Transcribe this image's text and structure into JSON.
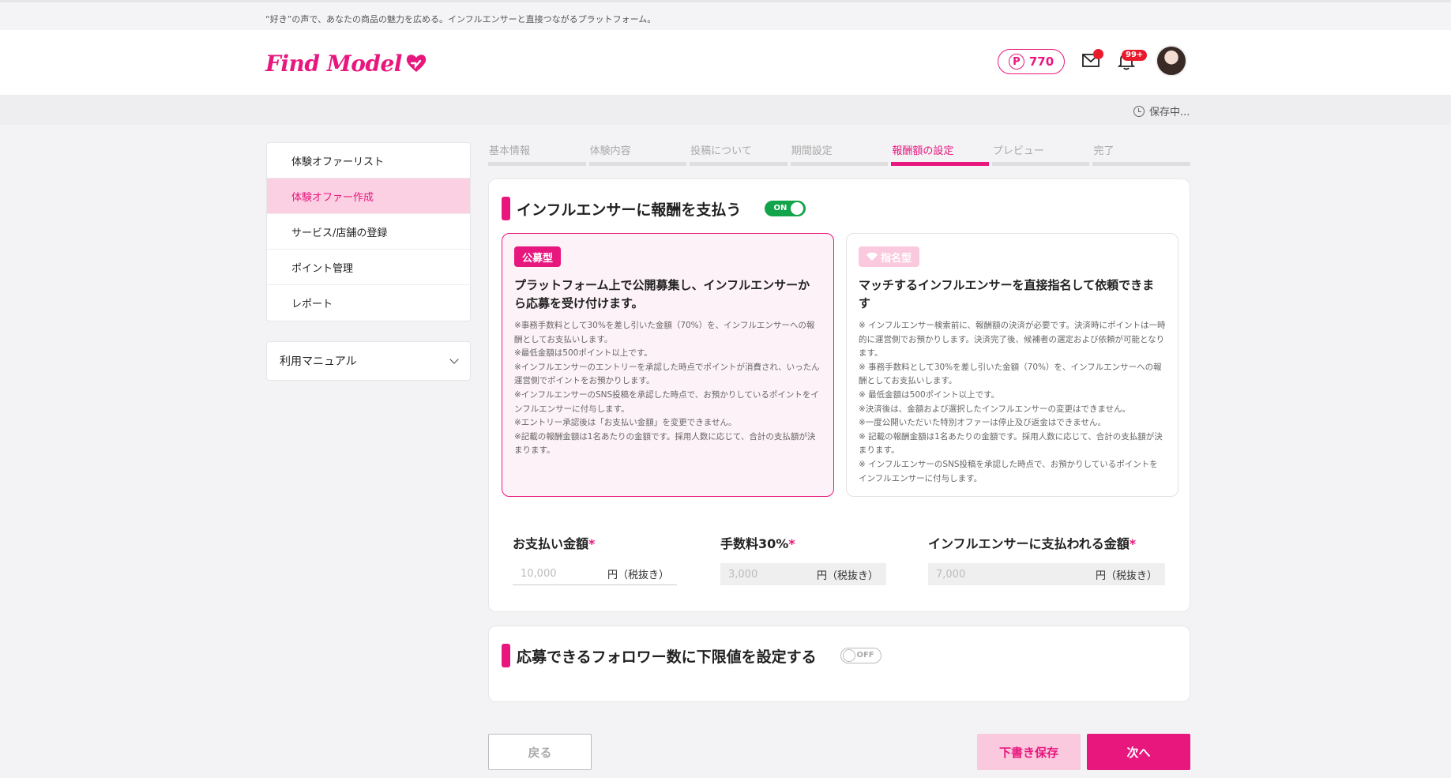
{
  "tagline": "“好き”の声で、あなたの商品の魅力を広める。インフルエンサーと直接つながるプラットフォーム。",
  "brand": {
    "logo_text": "Find Model",
    "accent": "#e8177e"
  },
  "header": {
    "points_symbol": "P",
    "points": "770",
    "mail_icon": "mail-icon",
    "bell_icon": "bell-icon",
    "notification_badge": "99+"
  },
  "saving_status": "保存中...",
  "sidebar": {
    "items": [
      {
        "label": "体験オファーリスト",
        "active": false
      },
      {
        "label": "体験オファー作成",
        "active": true
      },
      {
        "label": "サービス/店舗の登録",
        "active": false
      },
      {
        "label": "ポイント管理",
        "active": false
      },
      {
        "label": "レポート",
        "active": false
      }
    ],
    "manual": "利用マニュアル"
  },
  "steps": [
    {
      "label": "基本情報",
      "active": false
    },
    {
      "label": "体験内容",
      "active": false
    },
    {
      "label": "投稿について",
      "active": false
    },
    {
      "label": "期間設定",
      "active": false
    },
    {
      "label": "報酬額の設定",
      "active": true
    },
    {
      "label": "プレビュー",
      "active": false
    },
    {
      "label": "完了",
      "active": false
    }
  ],
  "reward": {
    "title": "インフルエンサーに報酬を支払う",
    "toggle": "ON",
    "option_public": {
      "badge": "公募型",
      "title": "プラットフォーム上で公開募集し、インフルエンサーから応募を受け付けます。",
      "notes": [
        "※事務手数料として30%を差し引いた金額（70%）を、インフルエンサーへの報酬としてお支払いします。",
        "※最低金額は500ポイント以上です。",
        "※インフルエンサーのエントリーを承認した時点でポイントが消費され、いったん運営側でポイントをお預かりします。",
        "※インフルエンサーのSNS投稿を承認した時点で、お預かりしているポイントをインフルエンサーに付与します。",
        "※エントリー承認後は「お支払い金額」を変更できません。",
        "※記載の報酬金額は1名あたりの金額です。採用人数に応じて、合計の支払額が決まります。"
      ]
    },
    "option_nominate": {
      "badge": "指名型",
      "title": "マッチするインフルエンサーを直接指名して依頼できます",
      "notes": [
        "※ インフルエンサー検索前に、報酬額の決済が必要です。決済時にポイントは一時的に運営側でお預かりします。決済完了後、候補者の選定および依頼が可能となります。",
        "※ 事務手数料として30%を差し引いた金額（70%）を、インフルエンサーへの報酬としてお支払いします。",
        "※ 最低金額は500ポイント以上です。",
        "※決済後は、金額および選択したインフルエンサーの変更はできません。",
        "※一度公開いただいた特別オファーは停止及び返金はできません。",
        "※ 記載の報酬金額は1名あたりの金額です。採用人数に応じて、合計の支払額が決まります。",
        "※ インフルエンサーのSNS投稿を承認した時点で、お預かりしているポイントをインフルエンサーに付与します。"
      ]
    },
    "fields": [
      {
        "label": "お支払い金額",
        "required": "*",
        "placeholder": "10,000",
        "unit": "円（税抜き）"
      },
      {
        "label": "手数料30%",
        "required": "*",
        "placeholder": "3,000",
        "unit": "円（税抜き）"
      },
      {
        "label": "インフルエンサーに支払われる金額",
        "required": "*",
        "placeholder": "7,000",
        "unit": "円（税抜き）"
      }
    ]
  },
  "follower_limit": {
    "title": "応募できるフォロワー数に下限値を設定する",
    "toggle": "OFF"
  },
  "buttons": {
    "back": "戻る",
    "draft": "下書き保存",
    "next": "次へ"
  }
}
